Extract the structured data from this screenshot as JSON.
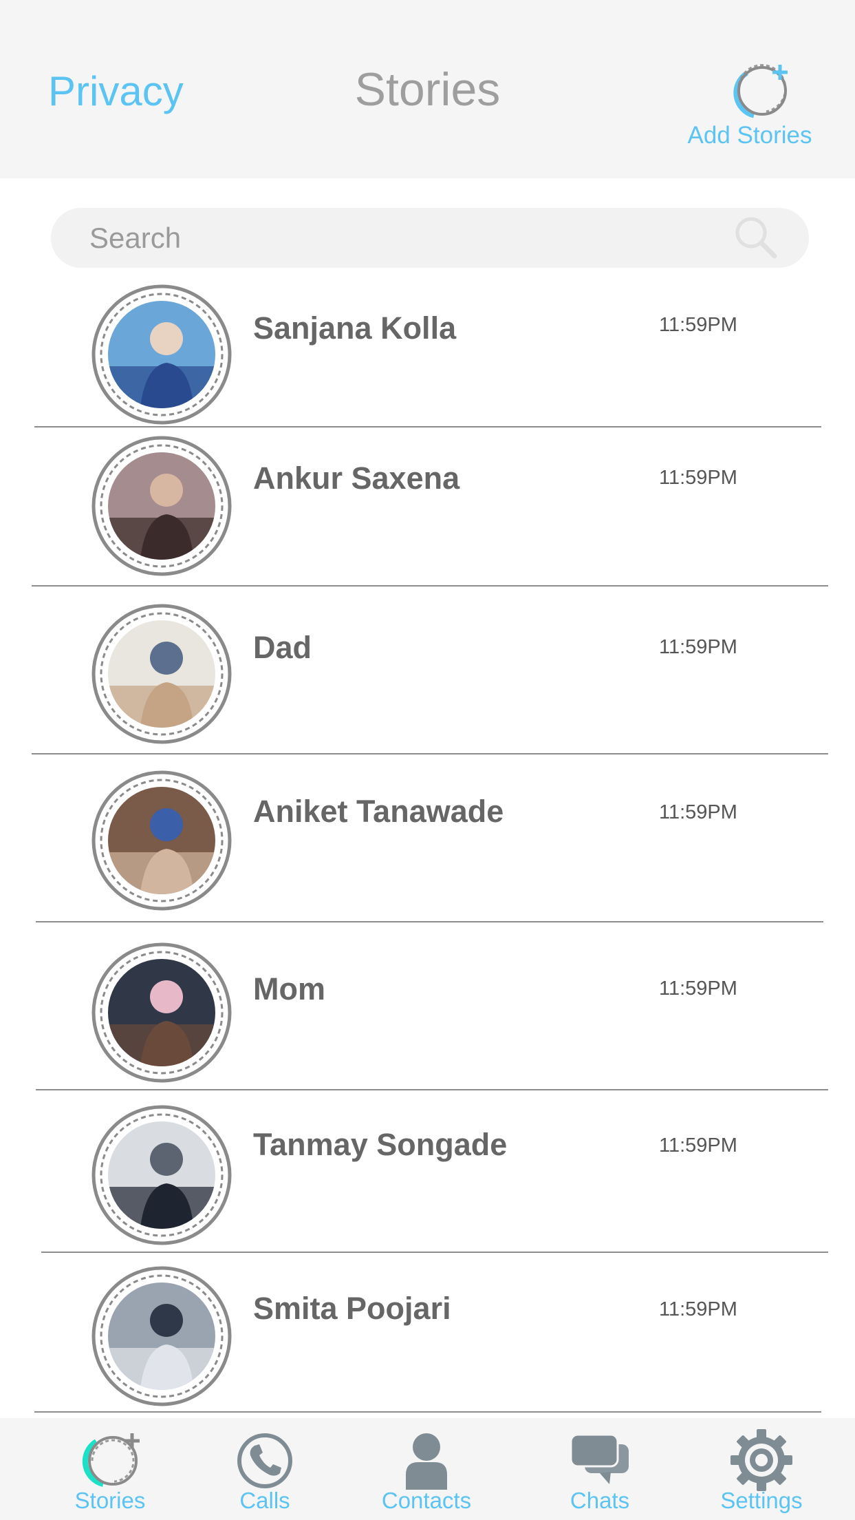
{
  "header": {
    "privacy_label": "Privacy",
    "title": "Stories",
    "add_stories_label": "Add Stories"
  },
  "search": {
    "placeholder": "Search"
  },
  "stories": [
    {
      "name": "Sanjana Kolla",
      "time": "11:59PM"
    },
    {
      "name": "Ankur Saxena",
      "time": "11:59PM"
    },
    {
      "name": "Dad",
      "time": "11:59PM"
    },
    {
      "name": "Aniket Tanawade",
      "time": "11:59PM"
    },
    {
      "name": "Mom",
      "time": "11:59PM"
    },
    {
      "name": "Tanmay Songade",
      "time": "11:59PM"
    },
    {
      "name": "Smita Poojari",
      "time": "11:59PM"
    }
  ],
  "tabs": [
    {
      "label": "Stories",
      "icon": "stories-icon",
      "active": true
    },
    {
      "label": "Calls",
      "icon": "phone-icon"
    },
    {
      "label": "Contacts",
      "icon": "person-icon"
    },
    {
      "label": "Chats",
      "icon": "chat-bubbles-icon"
    },
    {
      "label": "Settings",
      "icon": "gear-icon"
    }
  ],
  "colors": {
    "accent": "#5bc4f2",
    "active_tab_accent": "#1de0c8",
    "header_bg": "#f5f5f5",
    "name_text": "#666666",
    "icon_gray": "#7f8c94"
  }
}
